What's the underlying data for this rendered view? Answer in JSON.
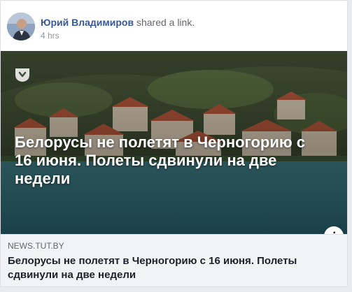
{
  "post": {
    "author_name": "Юрий Владимиров",
    "action_text": "shared a link.",
    "timestamp": "4 hrs",
    "avatar_icon": "user-avatar"
  },
  "link_preview": {
    "overlay_title": "Белорусы не полетят в Черногорию с 16 июня. Полеты сдвинули на две недели",
    "site_logo_icon": "tut-by-logo-icon",
    "info_button_label": "i",
    "domain": "NEWS.TUT.BY",
    "title": "Белорусы не полетят в Черногорию с 16 июня. Полеты сдвинули на две недели"
  },
  "colors": {
    "author_link": "#385898",
    "caption_background": "#f2f3f5",
    "card_background": "#ffffff"
  }
}
